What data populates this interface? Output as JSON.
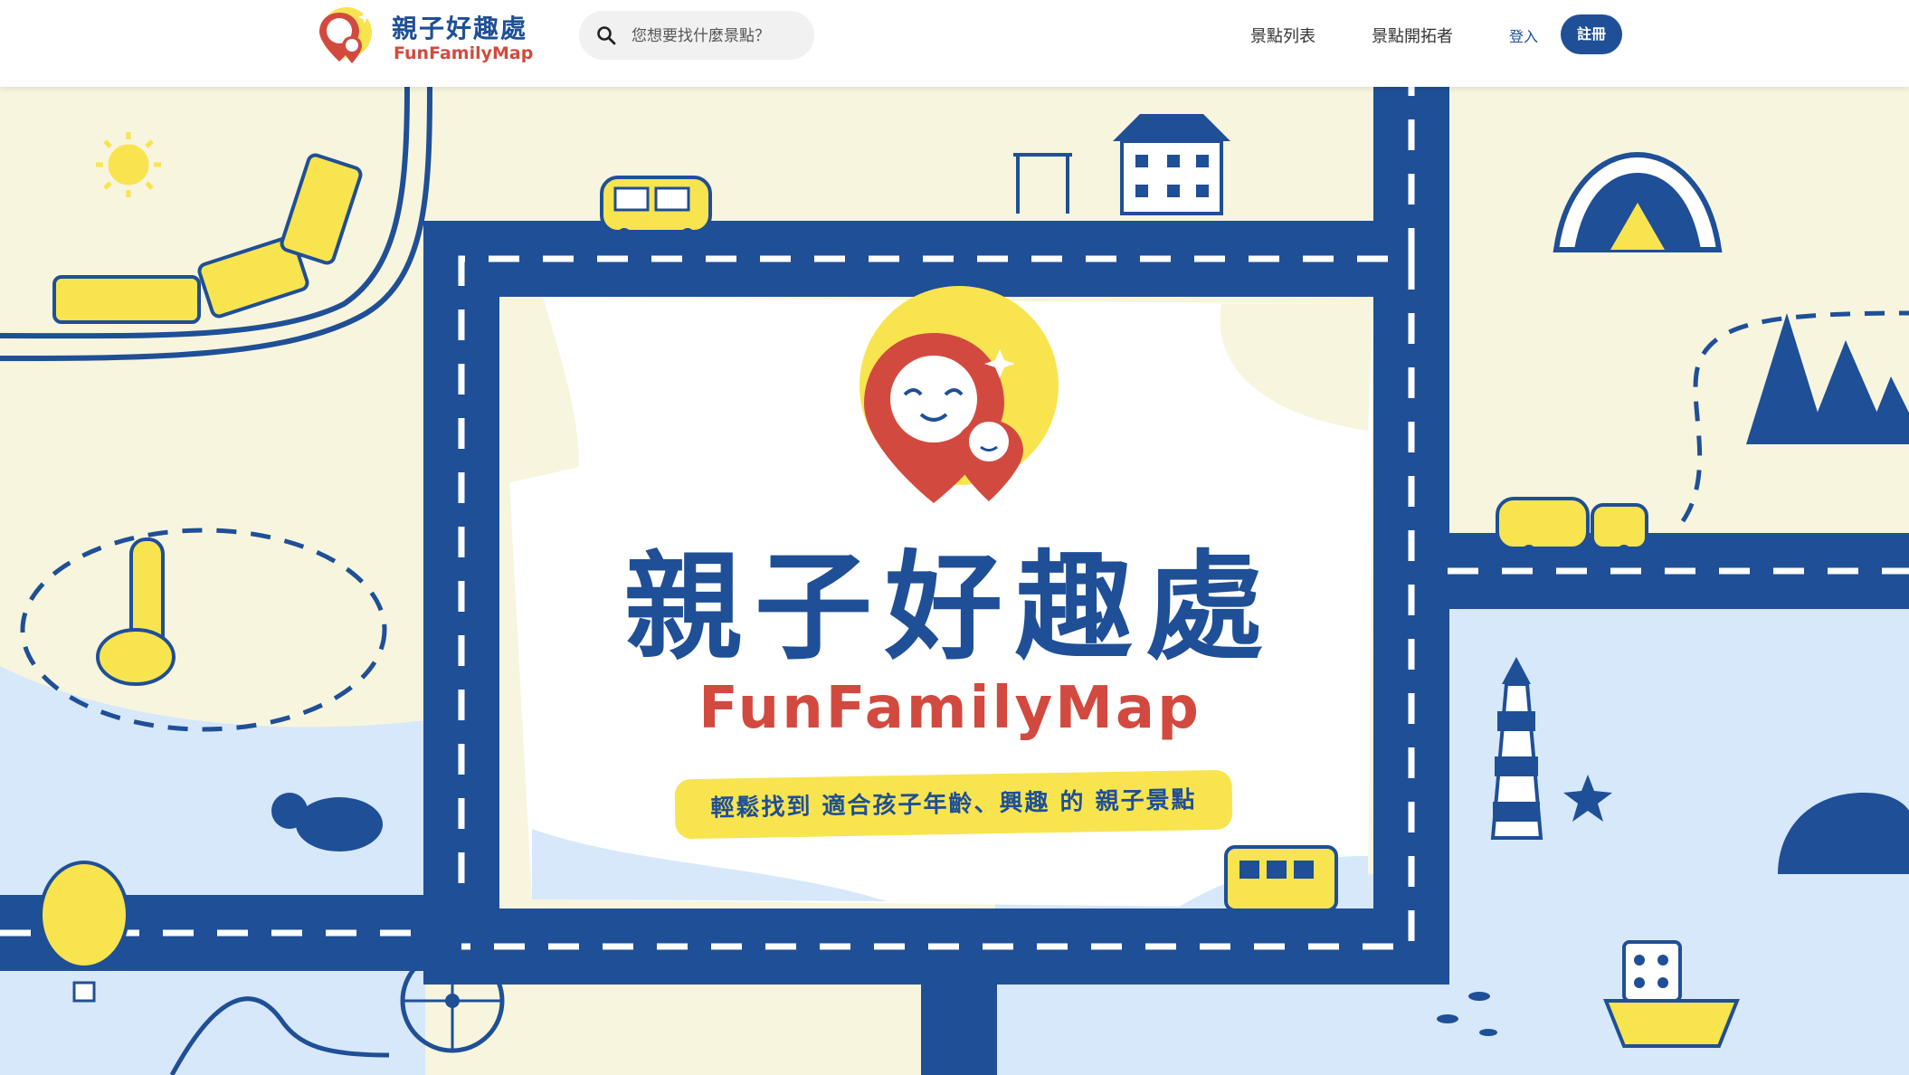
{
  "header": {
    "logo_title": "親子好趣處",
    "logo_subtitle": "FunFamilyMap",
    "search_placeholder": "您想要找什麼景點？",
    "nav": {
      "list_label": "景點列表",
      "pioneer_label": "景點開拓者",
      "login_label": "登入",
      "register_label": "註冊"
    }
  },
  "hero": {
    "title": "親子好趣處",
    "subtitle": "FunFamilyMap",
    "tagline": "輕鬆找到 適合孩子年齡、興趣 的 親子景點"
  },
  "colors": {
    "brand_blue": "#1f4f96",
    "brand_red": "#d24a3f",
    "accent_yellow": "#f8e44f",
    "land_cream": "#f7f5de",
    "water_blue": "#d6e8fa"
  },
  "icons": [
    "search-icon",
    "logo-pin-icon",
    "train-icon",
    "taxi-icon",
    "house-icon",
    "tent-icon",
    "giraffe-icon",
    "lighthouse-icon",
    "balloon-icon",
    "ferris-wheel-icon",
    "ship-icon",
    "whale-icon",
    "sun-icon",
    "tram-icon",
    "rhino-icon"
  ]
}
